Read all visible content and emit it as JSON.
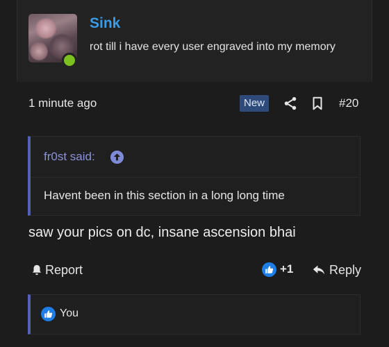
{
  "post": {
    "author": {
      "username": "Sink",
      "user_title": "rot till i have every user engraved into my memory",
      "online": true
    },
    "timestamp": "1 minute ago",
    "badge": "New",
    "post_number": "#20",
    "quote": {
      "author_label": "fr0st said:",
      "text": "Havent been in this section in a long long time"
    },
    "message": "saw your pics on dc, insane ascension bhai",
    "actions": {
      "report_label": "Report",
      "like_count": "+1",
      "reply_label": "Reply"
    },
    "reactions": {
      "users": "You"
    }
  },
  "colors": {
    "background": "#1c1c1c",
    "card": "#222222",
    "username": "#3a9be6",
    "online": "#7cc11f",
    "badge_bg": "#2d4a7a",
    "quote_accent": "#5561b8",
    "like_blue": "#1f7ee6"
  },
  "icons": [
    "share-icon",
    "bookmark-icon",
    "arrow-up-icon",
    "bell-icon",
    "like-icon",
    "reply-icon"
  ]
}
